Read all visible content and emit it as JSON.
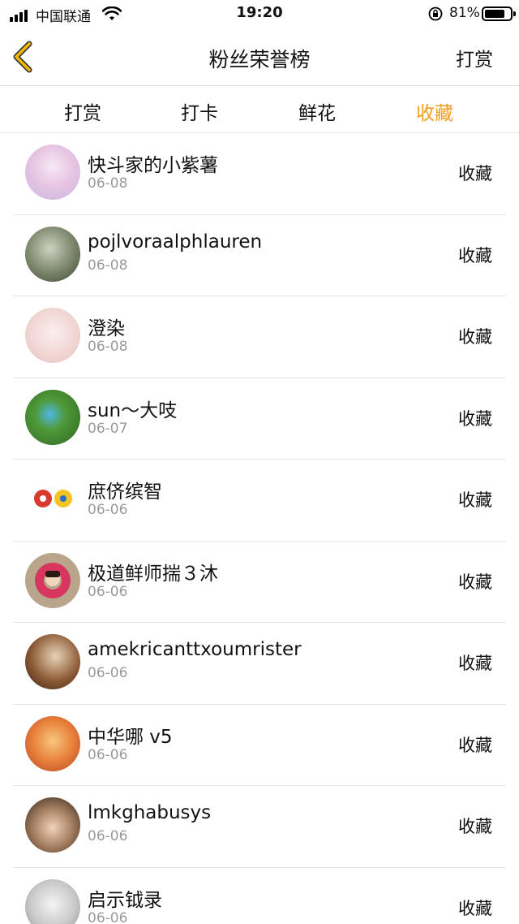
{
  "status_bar": {
    "carrier": "中国联通",
    "time": "19:20",
    "battery_percent": "81%",
    "battery_level": 0.81
  },
  "navbar": {
    "title": "粉丝荣誉榜",
    "right_action": "打赏"
  },
  "tabs": [
    {
      "label": "打赏",
      "active": false
    },
    {
      "label": "打卡",
      "active": false
    },
    {
      "label": "鲜花",
      "active": false
    },
    {
      "label": "收藏",
      "active": true
    }
  ],
  "colors": {
    "accent": "#f29d1b",
    "divider": "#e6e6e6",
    "secondary_text": "#9a9a9a",
    "back_arrow": "#f5b800"
  },
  "list": [
    {
      "name": "快斗家的小紫薯",
      "date": "06-08",
      "action": "收藏"
    },
    {
      "name": "pojlvoraalphlauren",
      "date": "06-08",
      "action": "收藏"
    },
    {
      "name": "澄染",
      "date": "06-08",
      "action": "收藏"
    },
    {
      "name": "sun～大吱",
      "date": "06-07",
      "action": "收藏"
    },
    {
      "name": "庶侪缤智",
      "date": "06-06",
      "action": "收藏"
    },
    {
      "name": "极道鲜师揣３沐",
      "date": "06-06",
      "action": "收藏"
    },
    {
      "name": "amekricanttxoumrister",
      "date": "06-06",
      "action": "收藏"
    },
    {
      "name": "中华哪 v5",
      "date": "06-06",
      "action": "收藏"
    },
    {
      "name": "lmkghabusys",
      "date": "06-06",
      "action": "收藏"
    },
    {
      "name": "启示钺录",
      "date": "06-06",
      "action": "收藏"
    }
  ]
}
